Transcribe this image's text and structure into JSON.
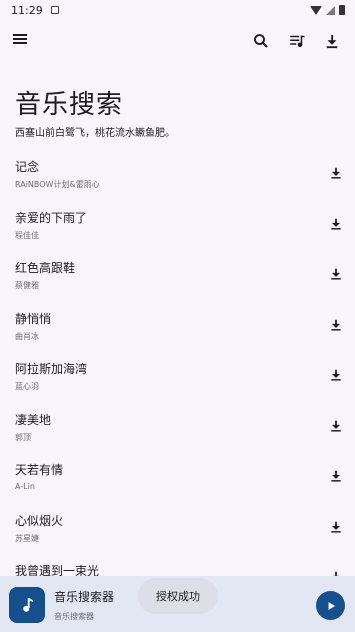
{
  "status_bar": {
    "time": "11:29"
  },
  "header": {
    "title": "音乐搜索",
    "subtitle": "西塞山前白鹭飞，桃花流水鳜鱼肥。"
  },
  "toolbar": {
    "menu_icon": "menu-icon",
    "search_icon": "search-icon",
    "queue_icon": "queue-music-icon",
    "download_icon": "download-icon"
  },
  "songs": [
    {
      "name": "记念",
      "artist": "RAiNBOW计划&雷雨心"
    },
    {
      "name": "亲爱的下雨了",
      "artist": "程佳佳"
    },
    {
      "name": "红色高跟鞋",
      "artist": "蔡健雅"
    },
    {
      "name": "静悄悄",
      "artist": "曲肖冰"
    },
    {
      "name": "阿拉斯加海湾",
      "artist": "蓝心羽"
    },
    {
      "name": "凄美地",
      "artist": "郭顶"
    },
    {
      "name": "天若有情",
      "artist": "A-Lin"
    },
    {
      "name": "心似烟火",
      "artist": "苏星婕"
    },
    {
      "name": "我曾遇到一束光",
      "artist": ""
    }
  ],
  "player": {
    "title": "音乐搜索器",
    "subtitle": "音乐搜索器",
    "accent": "#14508e"
  },
  "toast": {
    "message": "授权成功"
  }
}
